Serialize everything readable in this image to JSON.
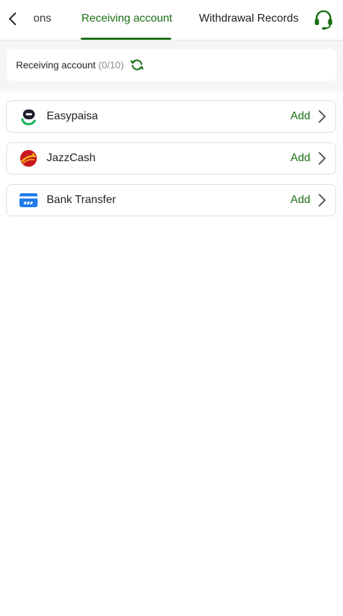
{
  "header": {
    "tabs": [
      {
        "label": "ons"
      },
      {
        "label": "Receiving account"
      },
      {
        "label": "Withdrawal Records"
      }
    ],
    "active_color": "#1a6e14",
    "back_icon": "chevron-left-icon",
    "support_icon": "headset-icon"
  },
  "summary": {
    "label": "Receiving account",
    "count": "(0/10)",
    "refresh_icon": "refresh-icon"
  },
  "methods": [
    {
      "name": "Easypaisa",
      "action": "Add",
      "logo": "easypaisa-logo"
    },
    {
      "name": "JazzCash",
      "action": "Add",
      "logo": "jazzcash-logo"
    },
    {
      "name": "Bank Transfer",
      "action": "Add",
      "logo": "bank-card-icon"
    }
  ]
}
